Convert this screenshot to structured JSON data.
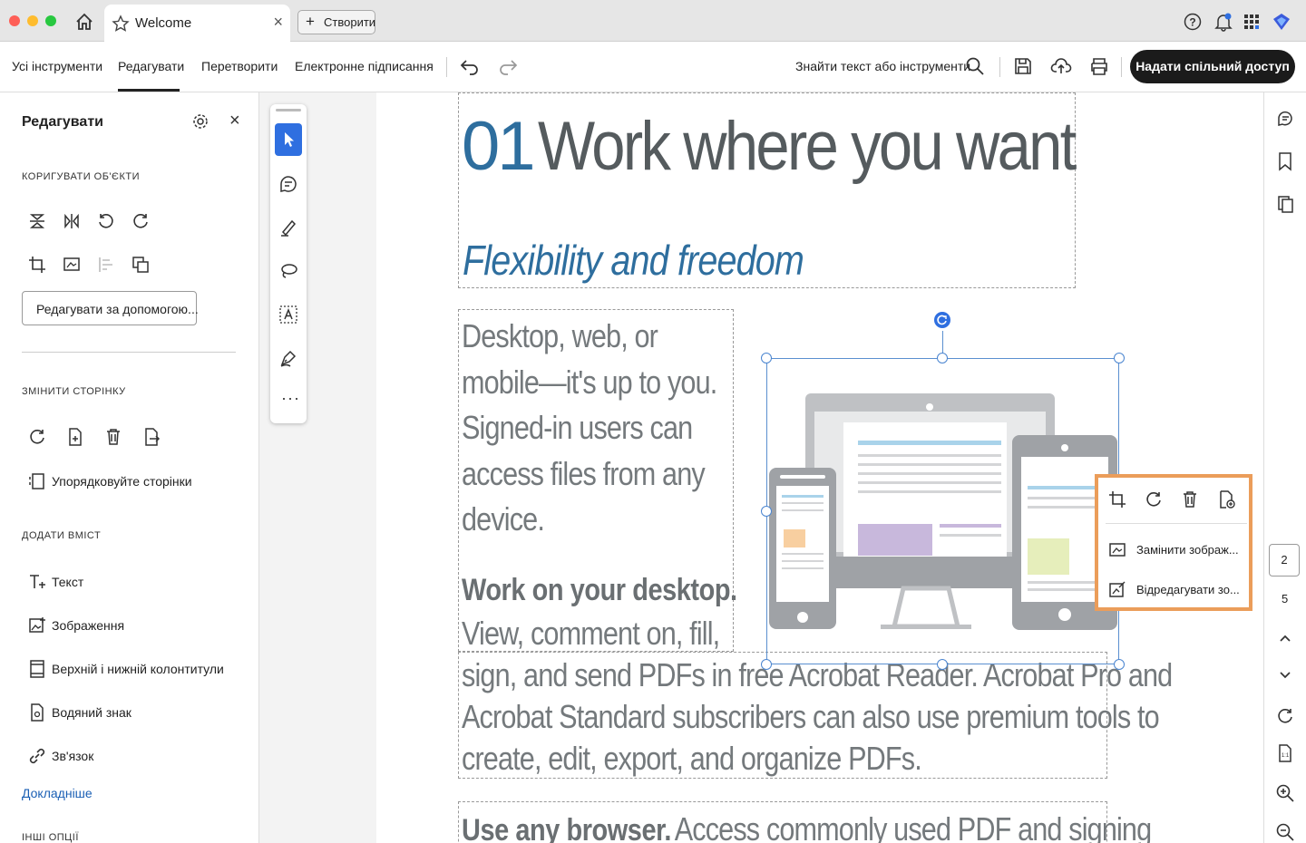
{
  "tabbar": {
    "tab_title": "Welcome",
    "new_button_label": "Створити"
  },
  "toolbar": {
    "menu": [
      "Усі інструменти",
      "Редагувати",
      "Перетворити",
      "Електронне підписання"
    ],
    "active_menu": "Редагувати",
    "search_label": "Знайти текст або інструменти",
    "share_label": "Надати спільний доступ"
  },
  "sidebar": {
    "title": "Редагувати",
    "section_adjust": "КОРИГУВАТИ ОБ'ЄКТИ",
    "edit_with_label": "Редагувати за допомогою...",
    "section_page": "ЗМІНИТИ СТОРІНКУ",
    "organize_label": "Упорядковуйте сторінки",
    "section_add": "ДОДАТИ ВМІСТ",
    "add_items": [
      "Текст",
      "Зображення",
      "Верхній і нижній колонтитули",
      "Водяний знак",
      "Зв'язок"
    ],
    "more_link": "Докладніше",
    "section_other": "ІНШІ ОПЦІЇ"
  },
  "document": {
    "heading_number": "01",
    "heading_text": "Work where you want",
    "subheading": "Flexibility and freedom",
    "para1_lines": [
      "Desktop, web, or",
      "mobile—it's up to you.",
      "Signed-in users can",
      "access files from any",
      "device."
    ],
    "bold_heading": "Work on your desktop.",
    "para2_lines": [
      "View, comment on, fill,",
      "sign, and send PDFs in free Acrobat Reader. Acrobat Pro and",
      "Acrobat Standard subscribers can also use premium tools to",
      "create, edit, export, and organize PDFs."
    ],
    "bold_heading2": "Use any browser.",
    "para3_start": "Access commonly used PDF and signing"
  },
  "context_menu": {
    "replace_label": "Замінити зображ...",
    "edit_label": "Відредагувати зо..."
  },
  "right_rail": {
    "current_page": "2",
    "total_pages": "5"
  },
  "colors": {
    "heading_blue": "#2e6e9e",
    "selection_blue": "#5a8fd0",
    "highlight_orange": "#eb9d5a",
    "tool_active": "#2f6fe0"
  }
}
